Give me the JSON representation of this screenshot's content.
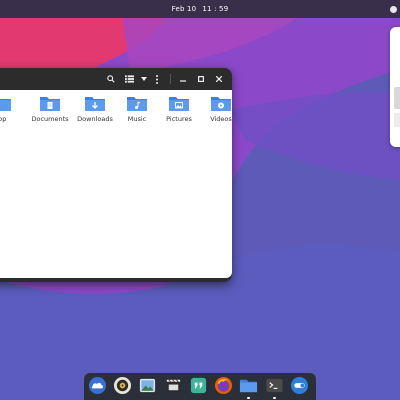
{
  "topbar": {
    "date": "Feb 10",
    "time": "11 : 59"
  },
  "colors": {
    "wallpaper_dark": "#5d5ab8",
    "wallpaper_pink": "#e0386f",
    "wallpaper_purple": "#9146c9",
    "topbar": "#3a2f4a",
    "window_header": "#2c2c2c",
    "folder_blue": "#4a8ce8",
    "dock_bg": "#2a2f3a"
  },
  "file_manager": {
    "header_icons": [
      "search-icon",
      "list-view-icon",
      "sort-dropdown-icon",
      "menu-icon",
      "minimize-icon",
      "maximize-icon",
      "close-icon"
    ],
    "folders": [
      {
        "label": "top",
        "icon": "desktop-folder-icon"
      },
      {
        "label": "Documents",
        "icon": "documents-folder-icon"
      },
      {
        "label": "Downloads",
        "icon": "downloads-folder-icon"
      },
      {
        "label": "Music",
        "icon": "music-folder-icon"
      },
      {
        "label": "Pictures",
        "icon": "pictures-folder-icon"
      },
      {
        "label": "Videos",
        "icon": "videos-folder-icon"
      }
    ]
  },
  "dock": {
    "items": [
      {
        "name": "weather-app-icon",
        "running": false
      },
      {
        "name": "rhythmbox-icon",
        "running": false
      },
      {
        "name": "image-viewer-icon",
        "running": false
      },
      {
        "name": "video-editor-icon",
        "running": false
      },
      {
        "name": "quotes-app-icon",
        "running": false
      },
      {
        "name": "firefox-icon",
        "running": false
      },
      {
        "name": "files-icon",
        "running": true
      },
      {
        "name": "terminal-icon",
        "running": true
      },
      {
        "name": "toggle-app-icon",
        "running": false
      }
    ]
  }
}
